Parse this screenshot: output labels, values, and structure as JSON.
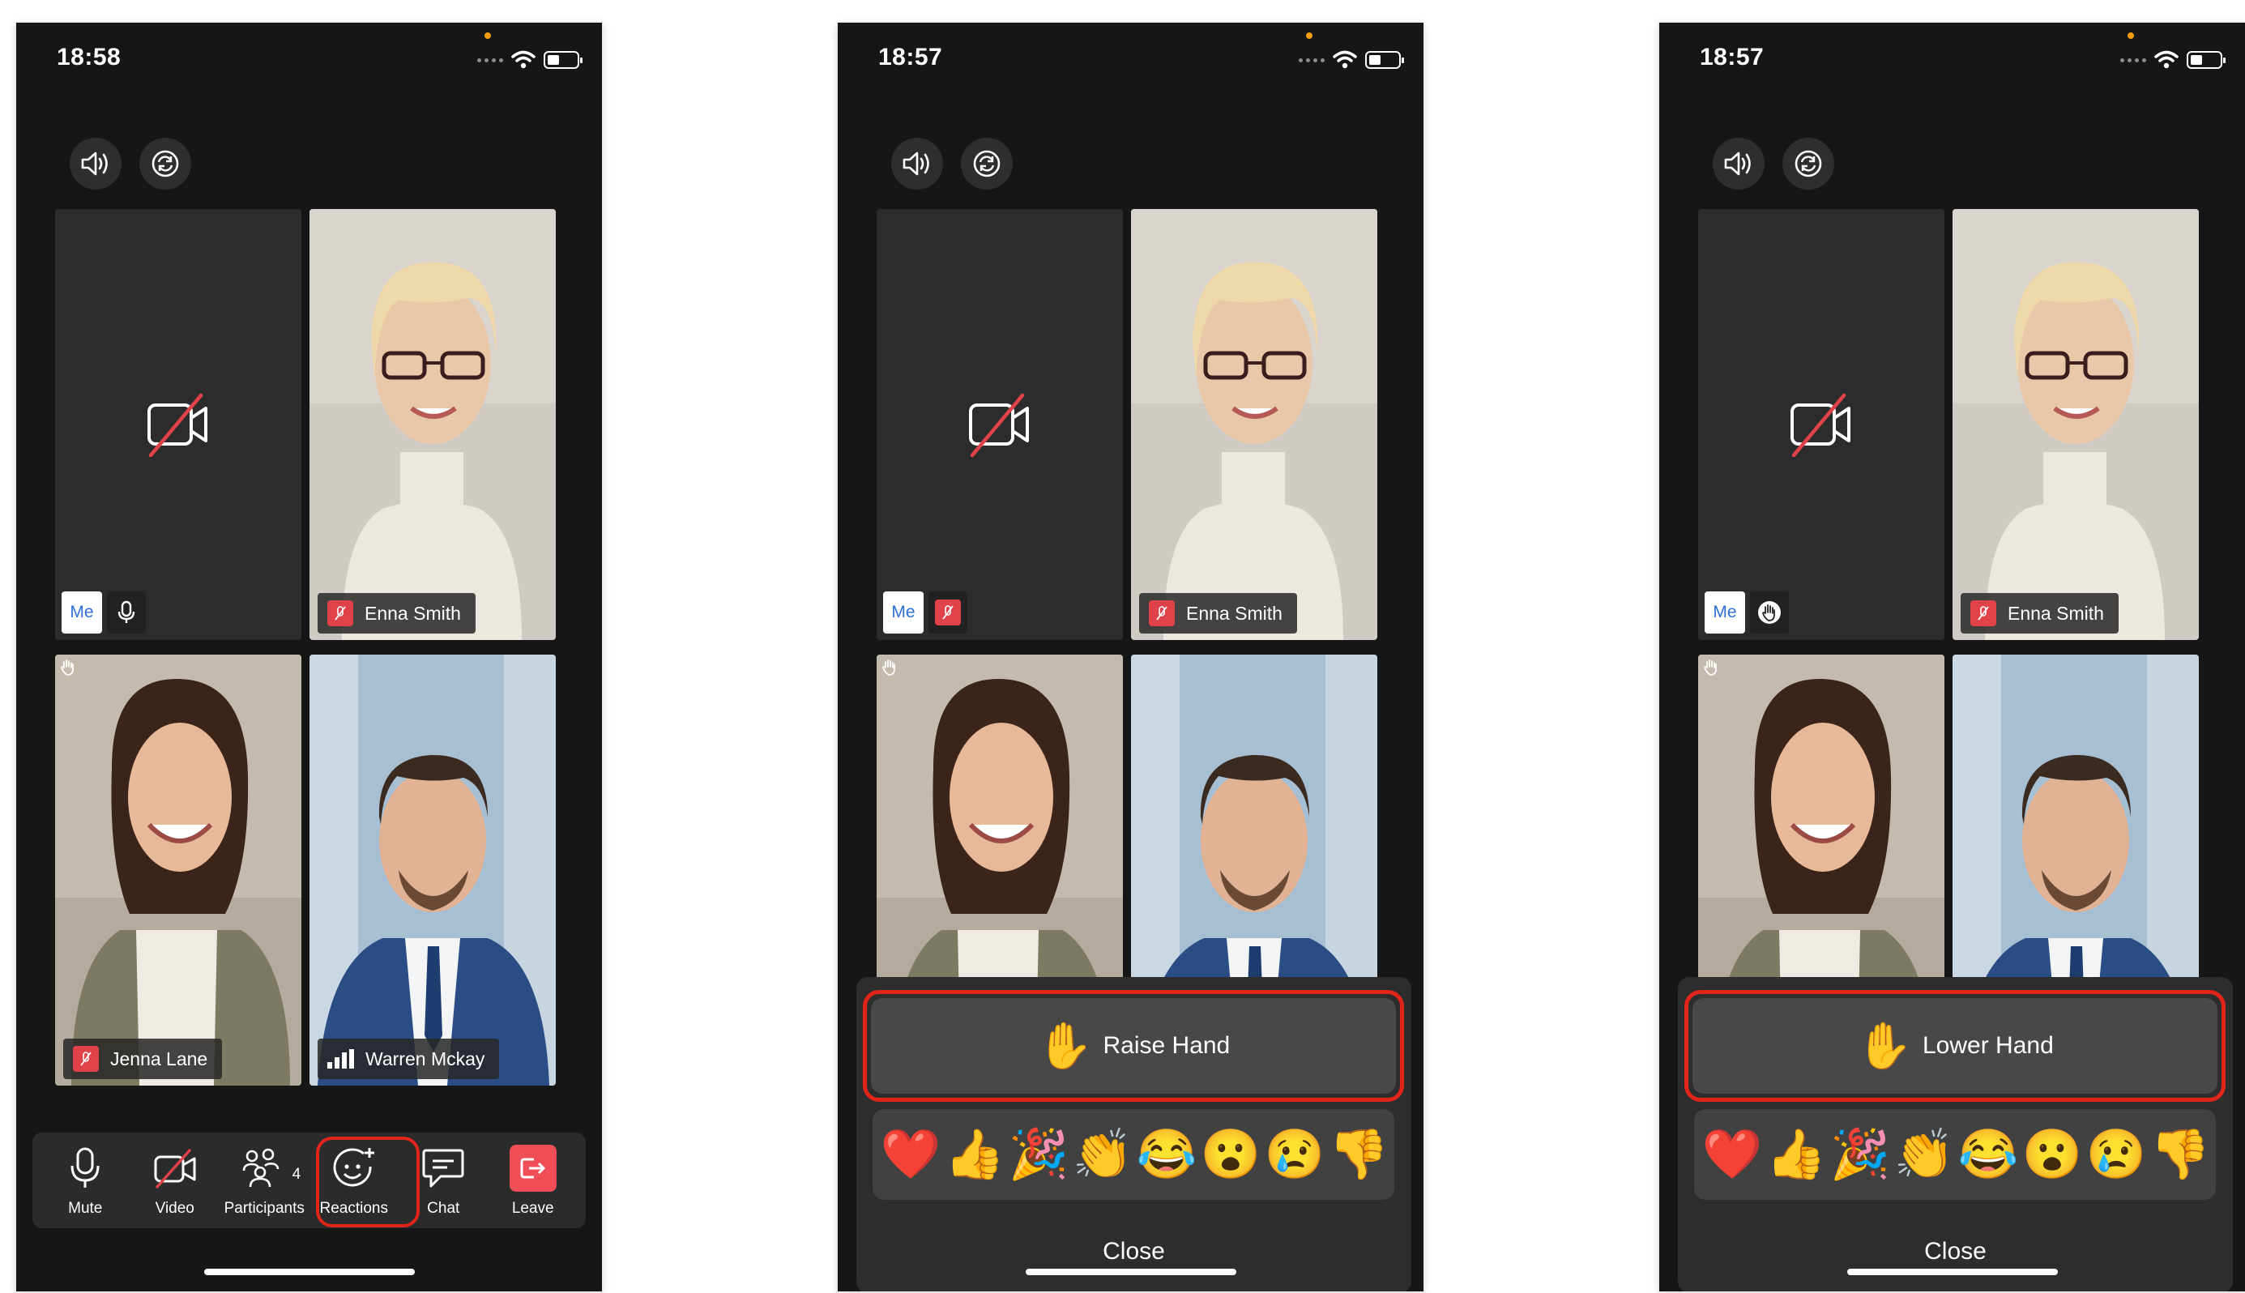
{
  "screens": [
    {
      "time": "18:58",
      "battery_level": 0.4,
      "tiles": {
        "me": {
          "label": "Me"
        },
        "enna": {
          "name": "Enna Smith"
        },
        "jenna": {
          "name": "Jenna Lane"
        },
        "warren": {
          "name": "Warren Mckay"
        }
      },
      "toolbar": {
        "mute_label": "Mute",
        "video_label": "Video",
        "participants_label": "Participants",
        "participants_count": "4",
        "reactions_label": "Reactions",
        "chat_label": "Chat",
        "leave_label": "Leave"
      }
    },
    {
      "time": "18:57",
      "battery_level": 0.4,
      "tiles": {
        "me": {
          "label": "Me"
        },
        "enna": {
          "name": "Enna Smith"
        }
      },
      "sheet": {
        "hand_button_label": "Raise Hand",
        "close_label": "Close"
      }
    },
    {
      "time": "18:57",
      "battery_level": 0.4,
      "tiles": {
        "me": {
          "label": "Me"
        },
        "enna": {
          "name": "Enna Smith"
        }
      },
      "sheet": {
        "hand_button_label": "Lower Hand",
        "close_label": "Close"
      }
    }
  ],
  "reactions": [
    "❤️",
    "👍",
    "🎉",
    "👏",
    "😂",
    "😮",
    "😢",
    "👎"
  ],
  "icons": {
    "hand": "✋",
    "speaker": "speaker-icon",
    "camera_switch": "camera-switch-icon",
    "camera_off": "camera-off-icon",
    "mic": "microphone-icon",
    "mic_muted": "microphone-muted-icon",
    "hand_raised": "hand-raised-icon",
    "signal": "signal-bars-icon",
    "people": "people-icon",
    "smiley": "smiley-add-icon",
    "chat": "chat-bubble-icon",
    "leave": "leave-icon"
  },
  "colors": {
    "background": "#161616",
    "tile": "#2c2c2c",
    "muted": "#e0424a",
    "leave": "#ef4e57",
    "highlight": "#e1251b",
    "me_text": "#2f6fd6"
  }
}
